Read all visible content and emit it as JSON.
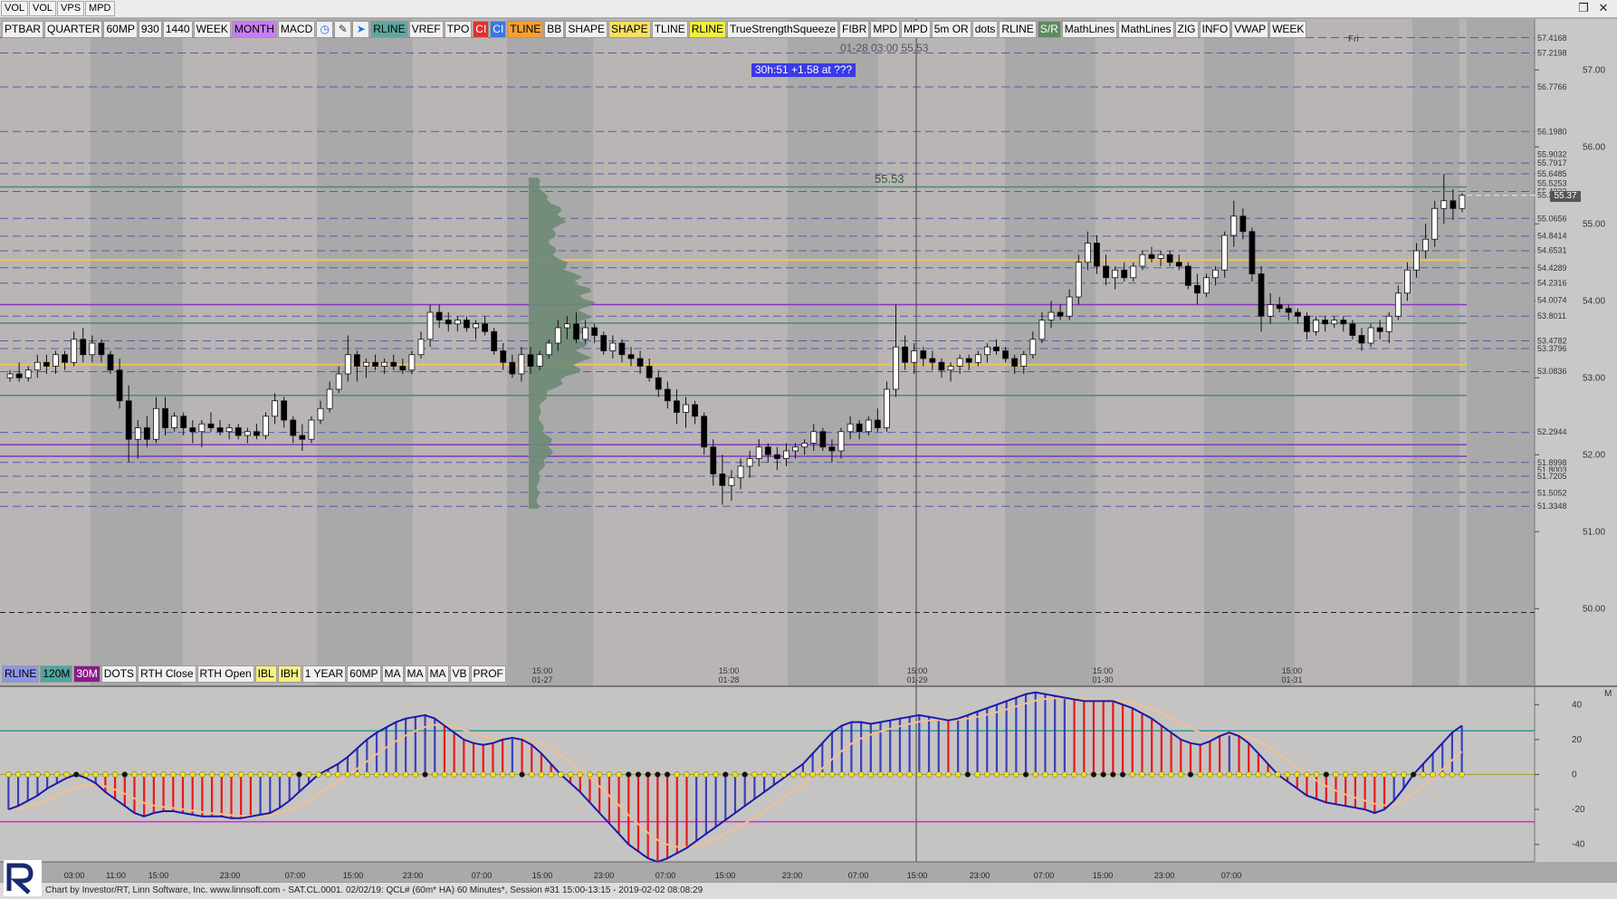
{
  "topbar": {
    "items": [
      "VOL",
      "VOL",
      "VPS",
      "MPD"
    ],
    "window_buttons": [
      "restore-icon",
      "close-icon"
    ]
  },
  "toolbar": {
    "buttons": [
      {
        "label": "PTBAR",
        "bg": "#f0f0f0"
      },
      {
        "label": "QUARTER",
        "bg": "#f0f0f0"
      },
      {
        "label": "60MP",
        "bg": "#f0f0f0"
      },
      {
        "label": "930",
        "bg": "#f0f0f0"
      },
      {
        "label": "1440",
        "bg": "#f0f0f0"
      },
      {
        "label": "WEEK",
        "bg": "#f0f0f0"
      },
      {
        "label": "MONTH",
        "bg": "#c77ef2"
      },
      {
        "label": "MACD",
        "bg": "#f0f0f0"
      },
      {
        "icon": "clock-icon"
      },
      {
        "icon": "pencil-icon"
      },
      {
        "icon": "cursor-icon"
      },
      {
        "label": "RLINE",
        "bg": "#5fa7a0"
      },
      {
        "label": "VREF",
        "bg": "#f0f0f0"
      },
      {
        "label": "TPO",
        "bg": "#f0f0f0"
      },
      {
        "label": "CI",
        "bg": "#e03030",
        "fg": "#ffffff"
      },
      {
        "label": "CI",
        "bg": "#3a78e0",
        "fg": "#ffffff"
      },
      {
        "label": "TLINE",
        "bg": "#f5a030"
      },
      {
        "label": "BB",
        "bg": "#f0f0f0"
      },
      {
        "label": "SHAPE",
        "bg": "#f0f0f0"
      },
      {
        "label": "SHAPE",
        "bg": "#f6e060"
      },
      {
        "label": "TLINE",
        "bg": "#f0f0f0"
      },
      {
        "label": "RLINE",
        "bg": "#f0f040"
      },
      {
        "label": "TrueStrengthSqueeze",
        "bg": "#f0f0f0"
      },
      {
        "label": "FIBR",
        "bg": "#f0f0f0"
      },
      {
        "label": "MPD",
        "bg": "#f0f0f0"
      },
      {
        "label": "MPD",
        "bg": "#f0f0f0"
      },
      {
        "label": "5m OR",
        "bg": "#f0f0f0"
      },
      {
        "label": "dots",
        "bg": "#f0f0f0"
      },
      {
        "label": "RLINE",
        "bg": "#f0f0f0"
      },
      {
        "label": "S/R",
        "bg": "#5e8a5e",
        "fg": "#ffffff"
      },
      {
        "label": "MathLines",
        "bg": "#f0f0f0"
      },
      {
        "label": "MathLines",
        "bg": "#f0f0f0"
      },
      {
        "label": "ZIG",
        "bg": "#f0f0f0"
      },
      {
        "label": "INFO",
        "bg": "#f0f0f0"
      },
      {
        "label": "VWAP",
        "bg": "#f0f0f0"
      },
      {
        "label": "WEEK",
        "bg": "#f0f0f0"
      }
    ]
  },
  "toolbar2": {
    "buttons": [
      {
        "label": "RLINE",
        "bg": "#8d96e8"
      },
      {
        "label": "120M",
        "bg": "#4fa6a0"
      },
      {
        "label": "30M",
        "bg": "#8a1a8a",
        "fg": "#ffffff"
      },
      {
        "label": "DOTS",
        "bg": "#f0f0f0"
      },
      {
        "label": "RTH Close",
        "bg": "#f0f0f0"
      },
      {
        "label": "RTH Open",
        "bg": "#f0f0f0"
      },
      {
        "label": "IBL",
        "bg": "#f6f080"
      },
      {
        "label": "IBH",
        "bg": "#f6f080"
      },
      {
        "label": "1 YEAR",
        "bg": "#f0f0f0"
      },
      {
        "label": "60MP",
        "bg": "#f0f0f0"
      },
      {
        "label": "MA",
        "bg": "#f0f0f0"
      },
      {
        "label": "MA",
        "bg": "#f0f0f0"
      },
      {
        "label": "MA",
        "bg": "#f0f0f0"
      },
      {
        "label": "VB",
        "bg": "#f0f0f0"
      },
      {
        "label": "PROF",
        "bg": "#f0f0f0"
      }
    ]
  },
  "overlay": {
    "crosshair_label": "01-28 03:00  55.53",
    "info_box": "30h:51  +1.58 at ???",
    "price_marker": "55.53",
    "day_label": "Fri",
    "last_price": "55.37"
  },
  "chart_data": {
    "type": "candlestick",
    "y_ticks": [
      "57.00",
      "56.00",
      "55.00",
      "54.00",
      "53.00",
      "52.00",
      "51.00",
      "50.00"
    ],
    "y_range": [
      49.25,
      57.65
    ],
    "price_labels": [
      "57.4168",
      "57.2198",
      "56.7766",
      "56.1980",
      "55.9032",
      "55.7917",
      "55.6485",
      "55.5253",
      "55.4223",
      "55.3708",
      "55.0656",
      "54.8414",
      "54.6531",
      "54.4289",
      "54.2316",
      "54.0074",
      "53.8011",
      "53.4782",
      "53.3796",
      "53.0836",
      "52.2944",
      "51.8998",
      "51.8003",
      "51.7205",
      "51.5052",
      "51.3348"
    ],
    "x_labels": [
      {
        "time": "15:00",
        "date": "01-27"
      },
      {
        "time": "15:00",
        "date": "01-28"
      },
      {
        "time": "15:00",
        "date": "01-29"
      },
      {
        "time": "15:00",
        "date": "01-30"
      },
      {
        "time": "15:00",
        "date": "01-31"
      }
    ],
    "candles": [
      [
        53.0,
        53.1,
        52.95,
        53.05
      ],
      [
        53.05,
        53.2,
        52.95,
        53.0
      ],
      [
        53.0,
        53.15,
        52.95,
        53.1
      ],
      [
        53.1,
        53.3,
        53.0,
        53.2
      ],
      [
        53.2,
        53.3,
        53.05,
        53.15
      ],
      [
        53.15,
        53.35,
        53.05,
        53.3
      ],
      [
        53.3,
        53.35,
        53.1,
        53.2
      ],
      [
        53.2,
        53.6,
        53.15,
        53.5
      ],
      [
        53.5,
        53.65,
        53.2,
        53.3
      ],
      [
        53.3,
        53.55,
        53.2,
        53.45
      ],
      [
        53.45,
        53.5,
        53.2,
        53.3
      ],
      [
        53.3,
        53.35,
        53.05,
        53.1
      ],
      [
        53.1,
        53.25,
        52.6,
        52.7
      ],
      [
        52.7,
        52.9,
        51.9,
        52.2
      ],
      [
        52.2,
        52.45,
        51.95,
        52.35
      ],
      [
        52.35,
        52.5,
        52.1,
        52.2
      ],
      [
        52.2,
        52.75,
        52.15,
        52.6
      ],
      [
        52.6,
        52.75,
        52.25,
        52.35
      ],
      [
        52.35,
        52.55,
        52.3,
        52.5
      ],
      [
        52.5,
        52.55,
        52.25,
        52.35
      ],
      [
        52.35,
        52.45,
        52.15,
        52.3
      ],
      [
        52.3,
        52.45,
        52.1,
        52.4
      ],
      [
        52.4,
        52.55,
        52.3,
        52.35
      ],
      [
        52.35,
        52.45,
        52.25,
        52.3
      ],
      [
        52.3,
        52.4,
        52.2,
        52.35
      ],
      [
        52.35,
        52.4,
        52.2,
        52.25
      ],
      [
        52.25,
        52.35,
        52.15,
        52.3
      ],
      [
        52.3,
        52.4,
        52.2,
        52.25
      ],
      [
        52.25,
        52.55,
        52.2,
        52.5
      ],
      [
        52.5,
        52.8,
        52.4,
        52.7
      ],
      [
        52.7,
        52.75,
        52.35,
        52.45
      ],
      [
        52.45,
        52.5,
        52.15,
        52.25
      ],
      [
        52.25,
        52.4,
        52.05,
        52.2
      ],
      [
        52.2,
        52.5,
        52.15,
        52.45
      ],
      [
        52.45,
        52.7,
        52.4,
        52.6
      ],
      [
        52.6,
        52.95,
        52.55,
        52.85
      ],
      [
        52.85,
        53.15,
        52.8,
        53.05
      ],
      [
        53.05,
        53.55,
        52.95,
        53.3
      ],
      [
        53.3,
        53.35,
        52.95,
        53.15
      ],
      [
        53.15,
        53.25,
        53.0,
        53.2
      ],
      [
        53.2,
        53.3,
        53.1,
        53.15
      ],
      [
        53.15,
        53.25,
        53.05,
        53.2
      ],
      [
        53.2,
        53.3,
        53.1,
        53.15
      ],
      [
        53.15,
        53.25,
        53.05,
        53.1
      ],
      [
        53.1,
        53.35,
        53.05,
        53.3
      ],
      [
        53.3,
        53.6,
        53.25,
        53.5
      ],
      [
        53.5,
        53.95,
        53.4,
        53.85
      ],
      [
        53.85,
        53.95,
        53.65,
        53.75
      ],
      [
        53.75,
        53.85,
        53.6,
        53.7
      ],
      [
        53.7,
        53.8,
        53.6,
        53.75
      ],
      [
        53.75,
        53.8,
        53.6,
        53.65
      ],
      [
        53.65,
        53.75,
        53.5,
        53.7
      ],
      [
        53.7,
        53.8,
        53.55,
        53.6
      ],
      [
        53.6,
        53.65,
        53.3,
        53.35
      ],
      [
        53.35,
        53.45,
        53.1,
        53.2
      ],
      [
        53.2,
        53.3,
        53.0,
        53.05
      ],
      [
        53.05,
        53.4,
        52.95,
        53.3
      ],
      [
        53.3,
        53.4,
        53.05,
        53.15
      ],
      [
        53.15,
        53.35,
        53.1,
        53.3
      ],
      [
        53.3,
        53.5,
        53.25,
        53.45
      ],
      [
        53.45,
        53.75,
        53.35,
        53.65
      ],
      [
        53.65,
        53.8,
        53.5,
        53.7
      ],
      [
        53.7,
        53.85,
        53.45,
        53.5
      ],
      [
        53.5,
        53.75,
        53.45,
        53.65
      ],
      [
        53.65,
        53.7,
        53.45,
        53.55
      ],
      [
        53.55,
        53.6,
        53.3,
        53.35
      ],
      [
        53.35,
        53.55,
        53.25,
        53.45
      ],
      [
        53.45,
        53.5,
        53.2,
        53.3
      ],
      [
        53.3,
        53.4,
        53.15,
        53.25
      ],
      [
        53.25,
        53.35,
        53.05,
        53.15
      ],
      [
        53.15,
        53.25,
        52.95,
        53.0
      ],
      [
        53.0,
        53.1,
        52.75,
        52.85
      ],
      [
        52.85,
        52.95,
        52.6,
        52.7
      ],
      [
        52.7,
        52.85,
        52.4,
        52.55
      ],
      [
        52.55,
        52.75,
        52.35,
        52.65
      ],
      [
        52.65,
        52.7,
        52.4,
        52.5
      ],
      [
        52.5,
        52.55,
        52.0,
        52.1
      ],
      [
        52.1,
        52.2,
        51.6,
        51.75
      ],
      [
        51.75,
        52.0,
        51.35,
        51.6
      ],
      [
        51.6,
        51.8,
        51.4,
        51.7
      ],
      [
        51.7,
        51.95,
        51.55,
        51.85
      ],
      [
        51.85,
        52.05,
        51.7,
        51.95
      ],
      [
        51.95,
        52.2,
        51.85,
        52.1
      ],
      [
        52.1,
        52.15,
        51.9,
        52.0
      ],
      [
        52.0,
        52.1,
        51.8,
        51.95
      ],
      [
        51.95,
        52.15,
        51.85,
        52.05
      ],
      [
        52.05,
        52.15,
        51.95,
        52.1
      ],
      [
        52.1,
        52.2,
        52.0,
        52.15
      ],
      [
        52.15,
        52.4,
        52.05,
        52.3
      ],
      [
        52.3,
        52.35,
        52.05,
        52.1
      ],
      [
        52.1,
        52.2,
        51.9,
        52.05
      ],
      [
        52.05,
        52.35,
        51.95,
        52.3
      ],
      [
        52.3,
        52.5,
        52.2,
        52.4
      ],
      [
        52.4,
        52.45,
        52.2,
        52.3
      ],
      [
        52.3,
        52.5,
        52.25,
        52.45
      ],
      [
        52.45,
        52.6,
        52.3,
        52.35
      ],
      [
        52.35,
        52.95,
        52.3,
        52.85
      ],
      [
        52.85,
        53.95,
        52.75,
        53.4
      ],
      [
        53.4,
        53.55,
        53.1,
        53.2
      ],
      [
        53.2,
        53.45,
        53.05,
        53.35
      ],
      [
        53.35,
        53.4,
        53.15,
        53.25
      ],
      [
        53.25,
        53.35,
        53.1,
        53.2
      ],
      [
        53.2,
        53.25,
        53.0,
        53.1
      ],
      [
        53.1,
        53.2,
        52.95,
        53.15
      ],
      [
        53.15,
        53.3,
        53.05,
        53.25
      ],
      [
        53.25,
        53.3,
        53.1,
        53.2
      ],
      [
        53.2,
        53.35,
        53.15,
        53.3
      ],
      [
        53.3,
        53.45,
        53.2,
        53.4
      ],
      [
        53.4,
        53.5,
        53.3,
        53.35
      ],
      [
        53.35,
        53.4,
        53.2,
        53.25
      ],
      [
        53.25,
        53.3,
        53.05,
        53.15
      ],
      [
        53.15,
        53.35,
        53.05,
        53.3
      ],
      [
        53.3,
        53.6,
        53.25,
        53.5
      ],
      [
        53.5,
        53.85,
        53.45,
        53.75
      ],
      [
        53.75,
        54.0,
        53.65,
        53.85
      ],
      [
        53.85,
        53.95,
        53.75,
        53.8
      ],
      [
        53.8,
        54.15,
        53.75,
        54.05
      ],
      [
        54.05,
        54.6,
        53.95,
        54.5
      ],
      [
        54.5,
        54.9,
        54.4,
        54.75
      ],
      [
        54.75,
        54.85,
        54.35,
        54.45
      ],
      [
        54.45,
        54.6,
        54.2,
        54.3
      ],
      [
        54.3,
        54.45,
        54.15,
        54.4
      ],
      [
        54.4,
        54.5,
        54.25,
        54.3
      ],
      [
        54.3,
        54.5,
        54.25,
        54.45
      ],
      [
        54.45,
        54.65,
        54.4,
        54.6
      ],
      [
        54.6,
        54.7,
        54.5,
        54.55
      ],
      [
        54.55,
        54.65,
        54.45,
        54.6
      ],
      [
        54.6,
        54.65,
        54.45,
        54.5
      ],
      [
        54.5,
        54.6,
        54.4,
        54.45
      ],
      [
        54.45,
        54.5,
        54.15,
        54.2
      ],
      [
        54.2,
        54.35,
        53.95,
        54.1
      ],
      [
        54.1,
        54.35,
        54.05,
        54.3
      ],
      [
        54.3,
        54.45,
        54.2,
        54.4
      ],
      [
        54.4,
        54.9,
        54.3,
        54.85
      ],
      [
        54.85,
        55.3,
        54.7,
        55.1
      ],
      [
        55.1,
        55.2,
        54.8,
        54.9
      ],
      [
        54.9,
        54.95,
        54.25,
        54.35
      ],
      [
        54.35,
        54.45,
        53.6,
        53.8
      ],
      [
        53.8,
        54.1,
        53.7,
        53.95
      ],
      [
        53.95,
        54.05,
        53.85,
        53.9
      ],
      [
        53.9,
        53.95,
        53.75,
        53.85
      ],
      [
        53.85,
        53.9,
        53.7,
        53.8
      ],
      [
        53.8,
        53.85,
        53.5,
        53.6
      ],
      [
        53.6,
        53.8,
        53.55,
        53.75
      ],
      [
        53.75,
        53.8,
        53.6,
        53.7
      ],
      [
        53.7,
        53.8,
        53.65,
        53.75
      ],
      [
        53.75,
        53.8,
        53.6,
        53.7
      ],
      [
        53.7,
        53.75,
        53.5,
        53.55
      ],
      [
        53.55,
        53.65,
        53.35,
        53.45
      ],
      [
        53.45,
        53.7,
        53.4,
        53.65
      ],
      [
        53.65,
        53.75,
        53.5,
        53.6
      ],
      [
        53.6,
        53.85,
        53.45,
        53.8
      ],
      [
        53.8,
        54.2,
        53.75,
        54.1
      ],
      [
        54.1,
        54.5,
        54.0,
        54.4
      ],
      [
        54.4,
        54.75,
        54.3,
        54.65
      ],
      [
        54.65,
        55.0,
        54.55,
        54.8
      ],
      [
        54.8,
        55.3,
        54.7,
        55.2
      ],
      [
        55.2,
        55.65,
        55.0,
        55.3
      ],
      [
        55.3,
        55.45,
        55.05,
        55.2
      ],
      [
        55.2,
        55.4,
        55.15,
        55.37
      ]
    ],
    "macd_ticks": [
      "40",
      "20",
      "0",
      "-20",
      "-40"
    ],
    "macd_range": [
      -50,
      50
    ],
    "macd_x_labels": [
      "03:00",
      "11:00",
      "15:00",
      "23:00",
      "07:00",
      "15:00",
      "23:00",
      "07:00",
      "15:00",
      "23:00",
      "07:00",
      "15:00",
      "23:00",
      "07:00",
      "15:00",
      "23:00",
      "07:00",
      "15:00",
      "23:00",
      "07:00"
    ],
    "macd_axis_label": "M",
    "macd": [
      -20,
      -18,
      -15,
      -12,
      -8,
      -5,
      -2,
      0,
      -2,
      -5,
      -10,
      -14,
      -18,
      -22,
      -24,
      -22,
      -21,
      -21,
      -22,
      -23,
      -24,
      -24,
      -24,
      -25,
      -25,
      -24,
      -23,
      -22,
      -19,
      -15,
      -10,
      -5,
      0,
      3,
      6,
      10,
      15,
      20,
      24,
      27,
      30,
      32,
      33,
      34,
      32,
      28,
      24,
      20,
      18,
      17,
      18,
      20,
      21,
      20,
      17,
      12,
      6,
      0,
      -5,
      -10,
      -16,
      -22,
      -28,
      -34,
      -40,
      -44,
      -48,
      -50,
      -48,
      -45,
      -42,
      -38,
      -34,
      -30,
      -26,
      -22,
      -18,
      -14,
      -10,
      -6,
      -2,
      2,
      6,
      12,
      18,
      24,
      28,
      30,
      30,
      29,
      30,
      31,
      32,
      33,
      34,
      33,
      32,
      31,
      32,
      34,
      36,
      38,
      40,
      42,
      44,
      46,
      47,
      46,
      45,
      44,
      43,
      42,
      42,
      42,
      42,
      40,
      38,
      35,
      32,
      28,
      24,
      20,
      18,
      17,
      19,
      22,
      24,
      22,
      18,
      12,
      6,
      0,
      -4,
      -8,
      -12,
      -14,
      -16,
      -17,
      -18,
      -19,
      -20,
      -22,
      -20,
      -15,
      -8,
      0,
      6,
      12,
      18,
      24,
      28
    ],
    "levels": {
      "dark_blue_dashed": [
        57.42,
        57.22,
        56.78,
        56.2,
        55.79,
        55.65,
        55.42,
        55.07,
        54.84,
        54.65,
        54.43,
        54.23,
        53.8,
        53.48,
        53.38,
        53.08,
        52.29,
        51.9,
        51.72,
        51.51,
        51.33
      ],
      "orange": [
        54.53,
        53.17
      ],
      "purple": [
        53.95,
        52.13,
        51.98
      ],
      "green": [
        55.48,
        53.71,
        52.77
      ]
    }
  },
  "footer": {
    "text": "Chart by Investor/RT, Linn Software, Inc. www.linnsoft.com - SAT.CL.0001.   02/02/19: QCL# (60m* HA) 60 Minutes*, Session #31 15:00-13:15 - 2019-02-02 08:08:29"
  },
  "colors": {
    "background": "#a9a9a9",
    "session_band": "#b9b5b5",
    "up_candle": "#ffffff",
    "down_candle": "#000000",
    "macd_pos": "#3840b8",
    "macd_neg": "#e81818",
    "macd_line": "#1a1aa8",
    "signal_line": "#f0c090"
  }
}
